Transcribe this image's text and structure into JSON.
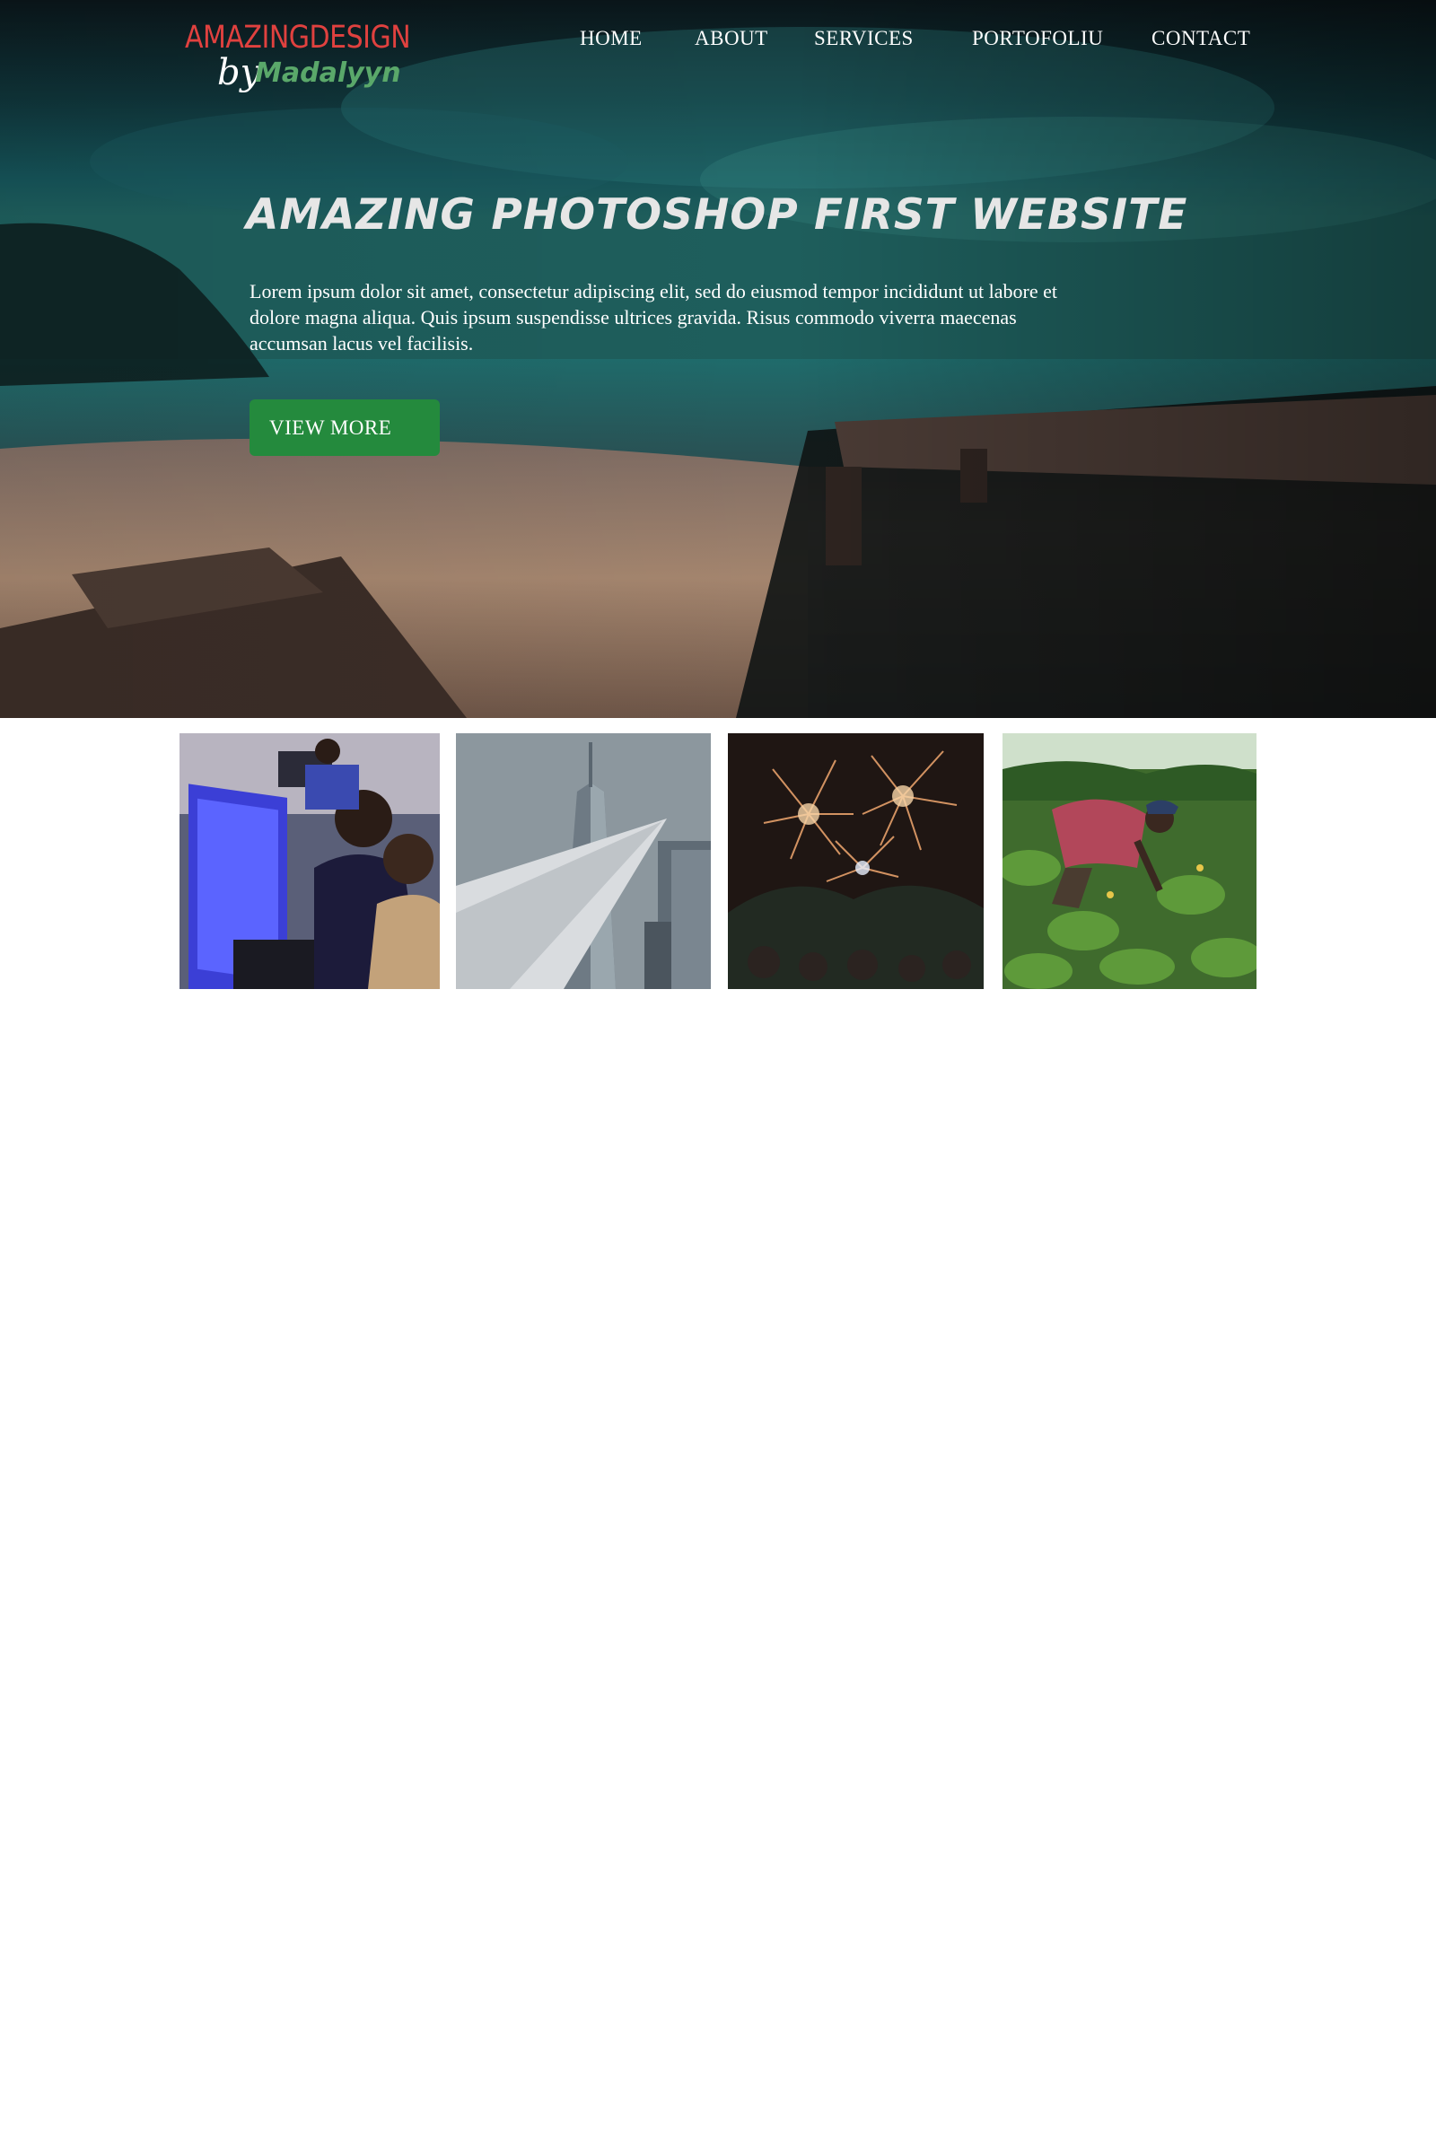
{
  "brand": {
    "line1": "AMAZINGDESIGN",
    "by": "by",
    "name": "Madalyyn",
    "colors": {
      "line1": "#e0413f",
      "name": "#5aa86a",
      "by": "#ffffff"
    }
  },
  "nav": {
    "items": [
      {
        "label": "HOME"
      },
      {
        "label": "ABOUT"
      },
      {
        "label": "SERVICES"
      },
      {
        "label": "PORTOFOLIU"
      },
      {
        "label": "CONTACT"
      }
    ]
  },
  "hero": {
    "title": "AMAZING PHOTOSHOP  FIRST WEBSITE",
    "text": "Lorem ipsum dolor sit amet, consectetur adipiscing elit, sed do eiusmod tempor incididunt ut labore et dolore magna aliqua. Quis ipsum suspendisse ultrices gravida. Risus commodo viverra maecenas accumsan lacus vel facilisis.",
    "cta_label": "VIEW MORE",
    "cta_color": "#248a3d",
    "background": "night beach with wooden pier"
  },
  "gallery": {
    "images": [
      {
        "name": "coding-team-photo"
      },
      {
        "name": "skyscraper-photo"
      },
      {
        "name": "fireworks-photo"
      },
      {
        "name": "farmer-field-photo"
      }
    ]
  }
}
